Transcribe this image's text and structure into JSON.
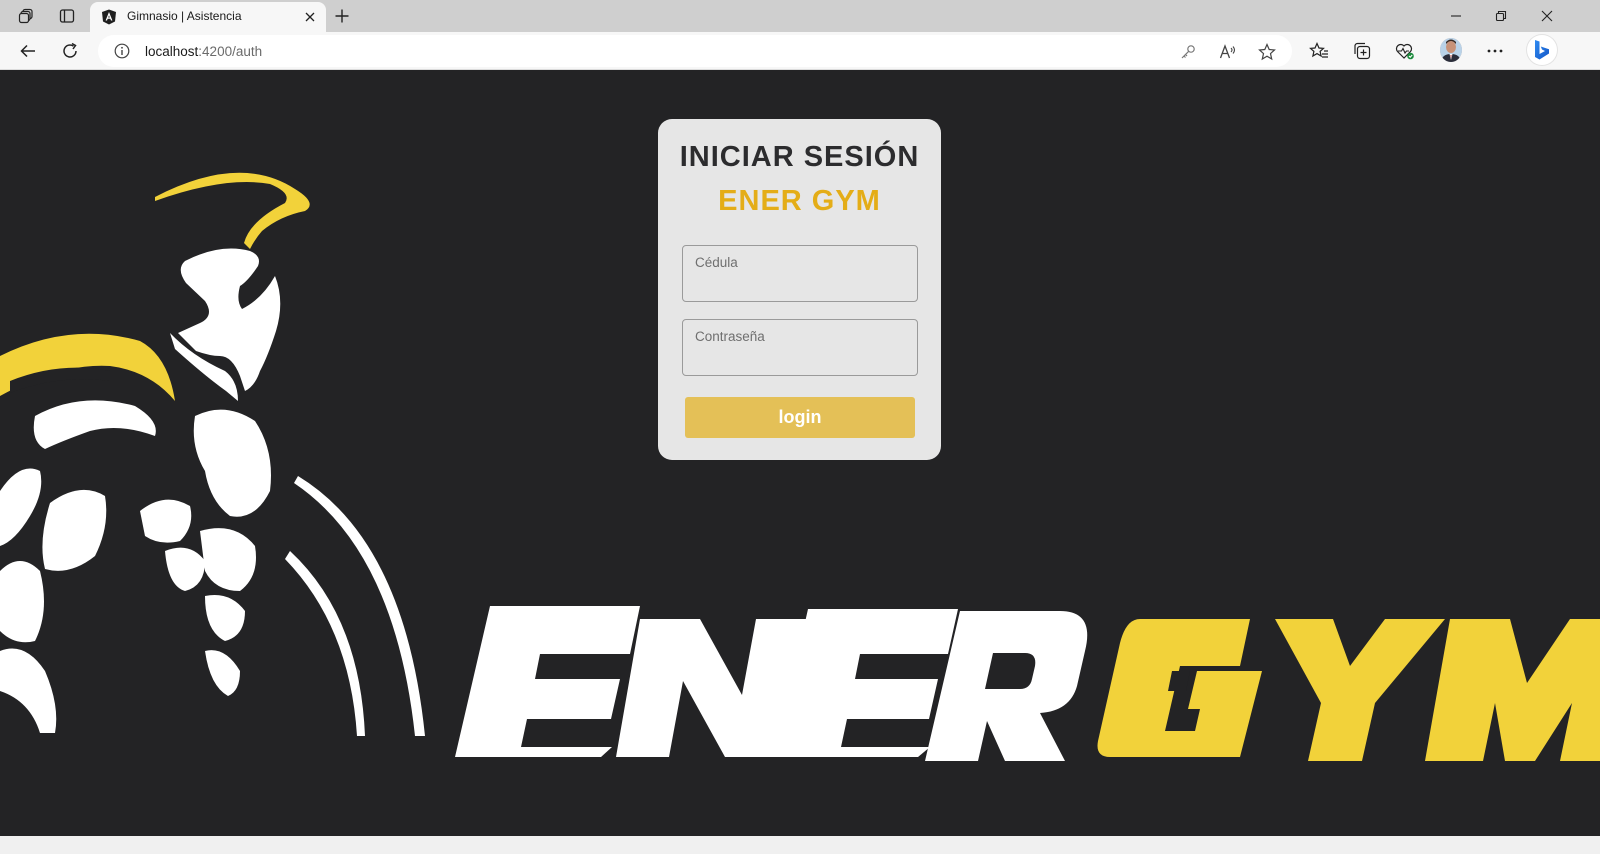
{
  "browser": {
    "tab_title": "Gimnasio | Asistencia",
    "url_host": "localhost",
    "url_path": ":4200/auth"
  },
  "login": {
    "title": "INICIAR SESIÓN",
    "subtitle": "ENER GYM",
    "cedula_label": "Cédula",
    "cedula_value": "",
    "password_label": "Contraseña",
    "password_value": "",
    "button_label": "login"
  },
  "background": {
    "brand_logo_text": "ENERGYM"
  },
  "colors": {
    "page_bg": "#232325",
    "accent_gold": "#e4ad17",
    "button": "#e4c057",
    "card": "#e6e6e6",
    "logo_yellow": "#f2d23a",
    "logo_white": "#ffffff"
  },
  "icons": {
    "workspaces": "workspaces-icon",
    "tab_actions": "tab-actions-icon",
    "favicon": "angular-icon",
    "close_tab": "close-icon",
    "new_tab": "plus-icon",
    "minimize": "minimize-icon",
    "restore": "restore-icon",
    "close_window": "close-icon",
    "back": "back-arrow-icon",
    "refresh": "refresh-icon",
    "site_info": "info-icon",
    "password_key": "key-icon",
    "read_aloud": "read-aloud-icon",
    "favorite": "star-icon",
    "favorites": "favorites-icon",
    "collections": "collections-icon",
    "health": "browser-essentials-icon",
    "profile": "avatar",
    "more": "more-icon",
    "copilot": "bing-icon"
  }
}
